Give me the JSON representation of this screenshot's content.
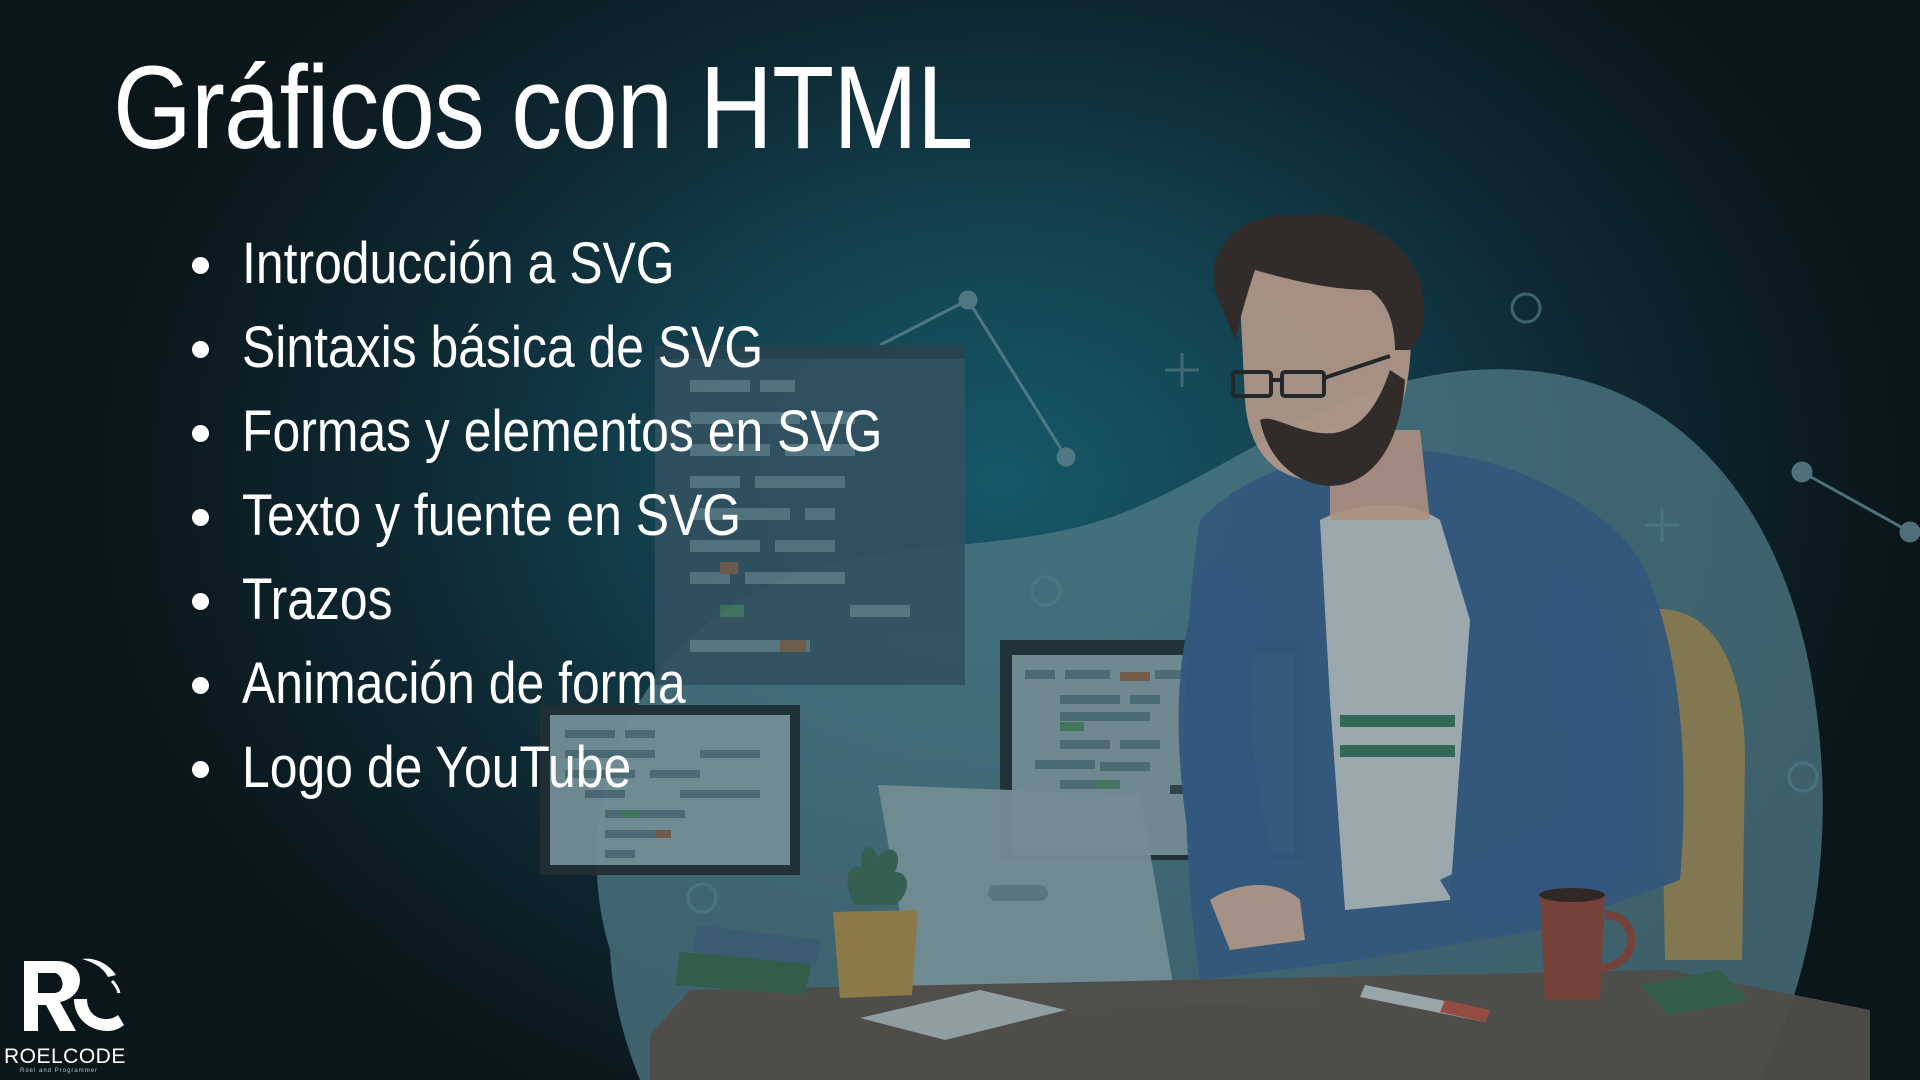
{
  "slide": {
    "title": "Gráficos con HTML",
    "topics": [
      "Introducción a SVG",
      "Sintaxis básica de SVG",
      "Formas y elementos en SVG",
      "Texto y fuente en SVG",
      "Trazos",
      "Animación de forma",
      "Logo de YouTube"
    ]
  },
  "brand": {
    "name": "ROELCODE",
    "tagline": "Roel and Programmer"
  },
  "colors": {
    "background_center": "#1a6577",
    "background_edge": "#0b151a",
    "text": "#ffffff",
    "blob": "#5f8f9c",
    "shirt": "#3b6590",
    "chair": "#a99156",
    "desk": "#5e5650"
  },
  "icons": [
    "developer-illustration",
    "roelcode-logo"
  ]
}
